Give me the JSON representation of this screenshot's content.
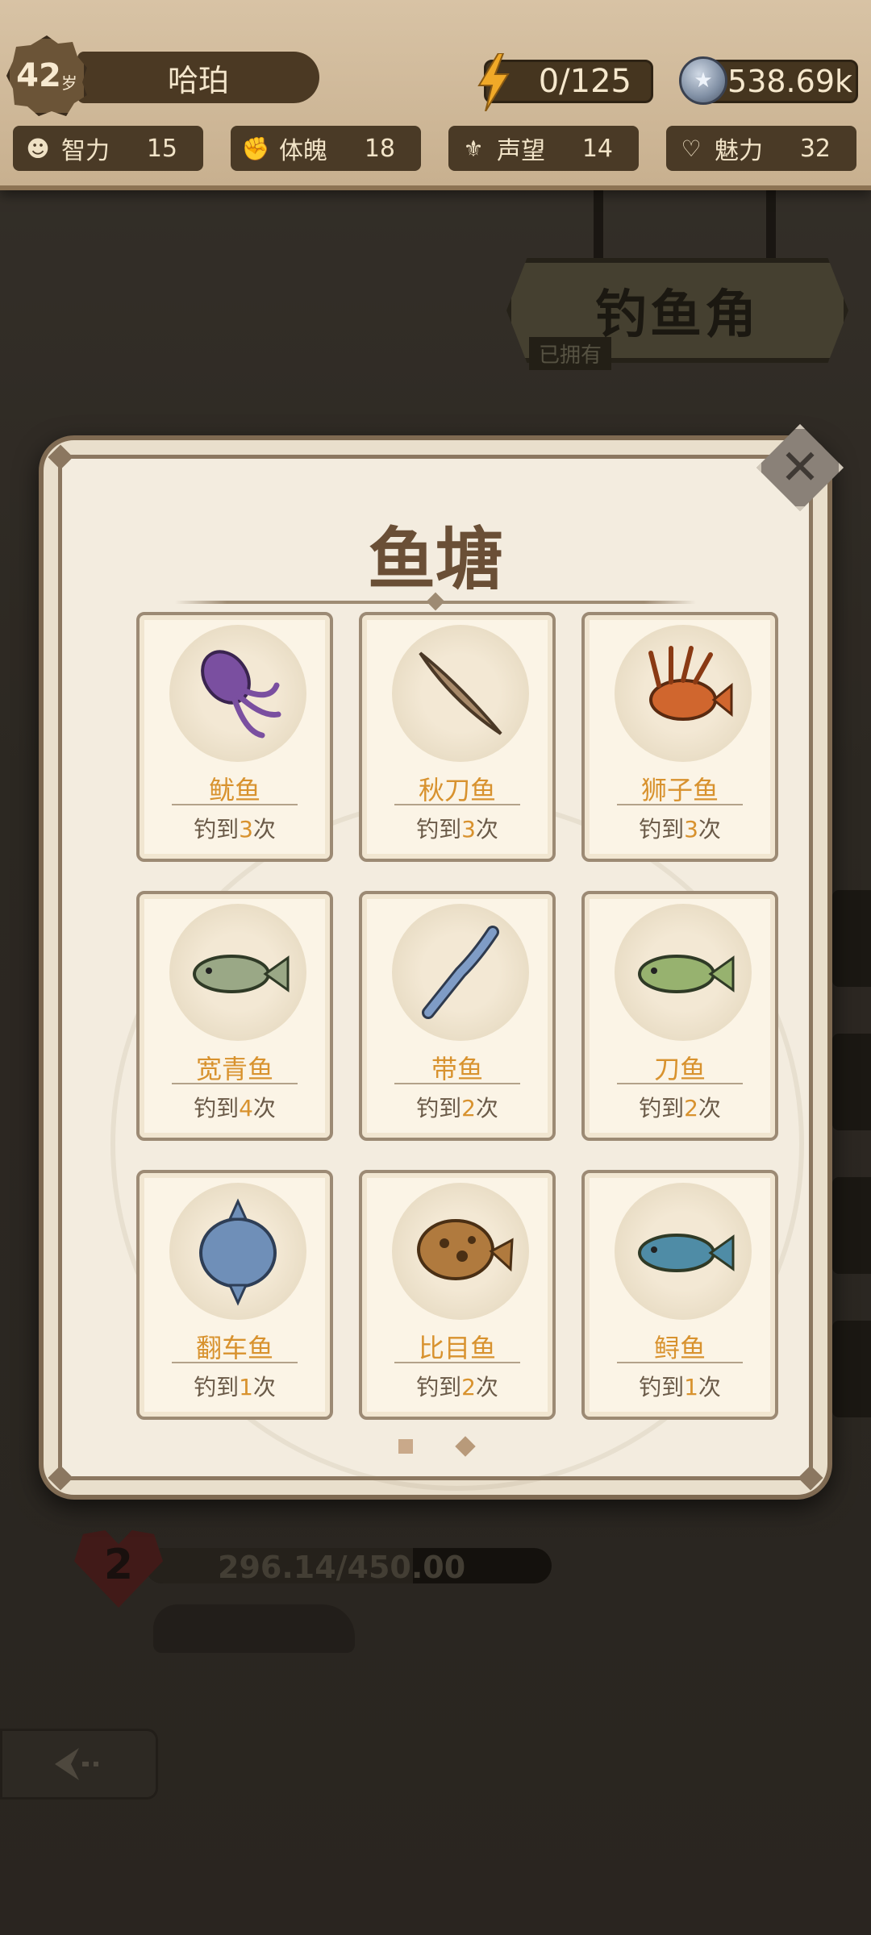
{
  "status": {
    "age": "42",
    "age_unit": "岁",
    "name": "哈珀",
    "energy": "0/125",
    "coins": "538.69k"
  },
  "stats": [
    {
      "label": "智力",
      "value": "15",
      "icon": "brain-icon"
    },
    {
      "label": "体魄",
      "value": "18",
      "icon": "muscle-icon"
    },
    {
      "label": "声望",
      "value": "14",
      "icon": "reputation-icon"
    },
    {
      "label": "魅力",
      "value": "32",
      "icon": "heart-pulse-icon"
    }
  ],
  "location": {
    "title": "钓鱼角",
    "owned_label": "已拥有"
  },
  "life": {
    "count": "2",
    "hp_text": "296.14/450.00",
    "hp_fraction": 0.658
  },
  "modal": {
    "title": "鱼塘",
    "caught_prefix": "钓到",
    "caught_suffix": "次",
    "fish": [
      {
        "name": "鱿鱼",
        "count": "3",
        "icon": "squid-icon",
        "color": "#7a4fa0"
      },
      {
        "name": "秋刀鱼",
        "count": "3",
        "icon": "saury-icon",
        "color": "#a88a6a"
      },
      {
        "name": "狮子鱼",
        "count": "3",
        "icon": "lionfish-icon",
        "color": "#d0662e"
      },
      {
        "name": "宽青鱼",
        "count": "4",
        "icon": "bream-icon",
        "color": "#9aa886"
      },
      {
        "name": "带鱼",
        "count": "2",
        "icon": "ribbonfish-icon",
        "color": "#7f9cc6"
      },
      {
        "name": "刀鱼",
        "count": "2",
        "icon": "knifefish-icon",
        "color": "#97b26f"
      },
      {
        "name": "翻车鱼",
        "count": "1",
        "icon": "sunfish-icon",
        "color": "#6f8fb8"
      },
      {
        "name": "比目鱼",
        "count": "2",
        "icon": "flounder-icon",
        "color": "#b07a3e"
      },
      {
        "name": "鲟鱼",
        "count": "1",
        "icon": "sturgeon-icon",
        "color": "#4f8ca6"
      }
    ],
    "page_count": 2,
    "current_page": 1
  },
  "colors": {
    "accent": "#d8922e",
    "panel": "#f3ecdf",
    "topbar": "#d8c3a5"
  }
}
